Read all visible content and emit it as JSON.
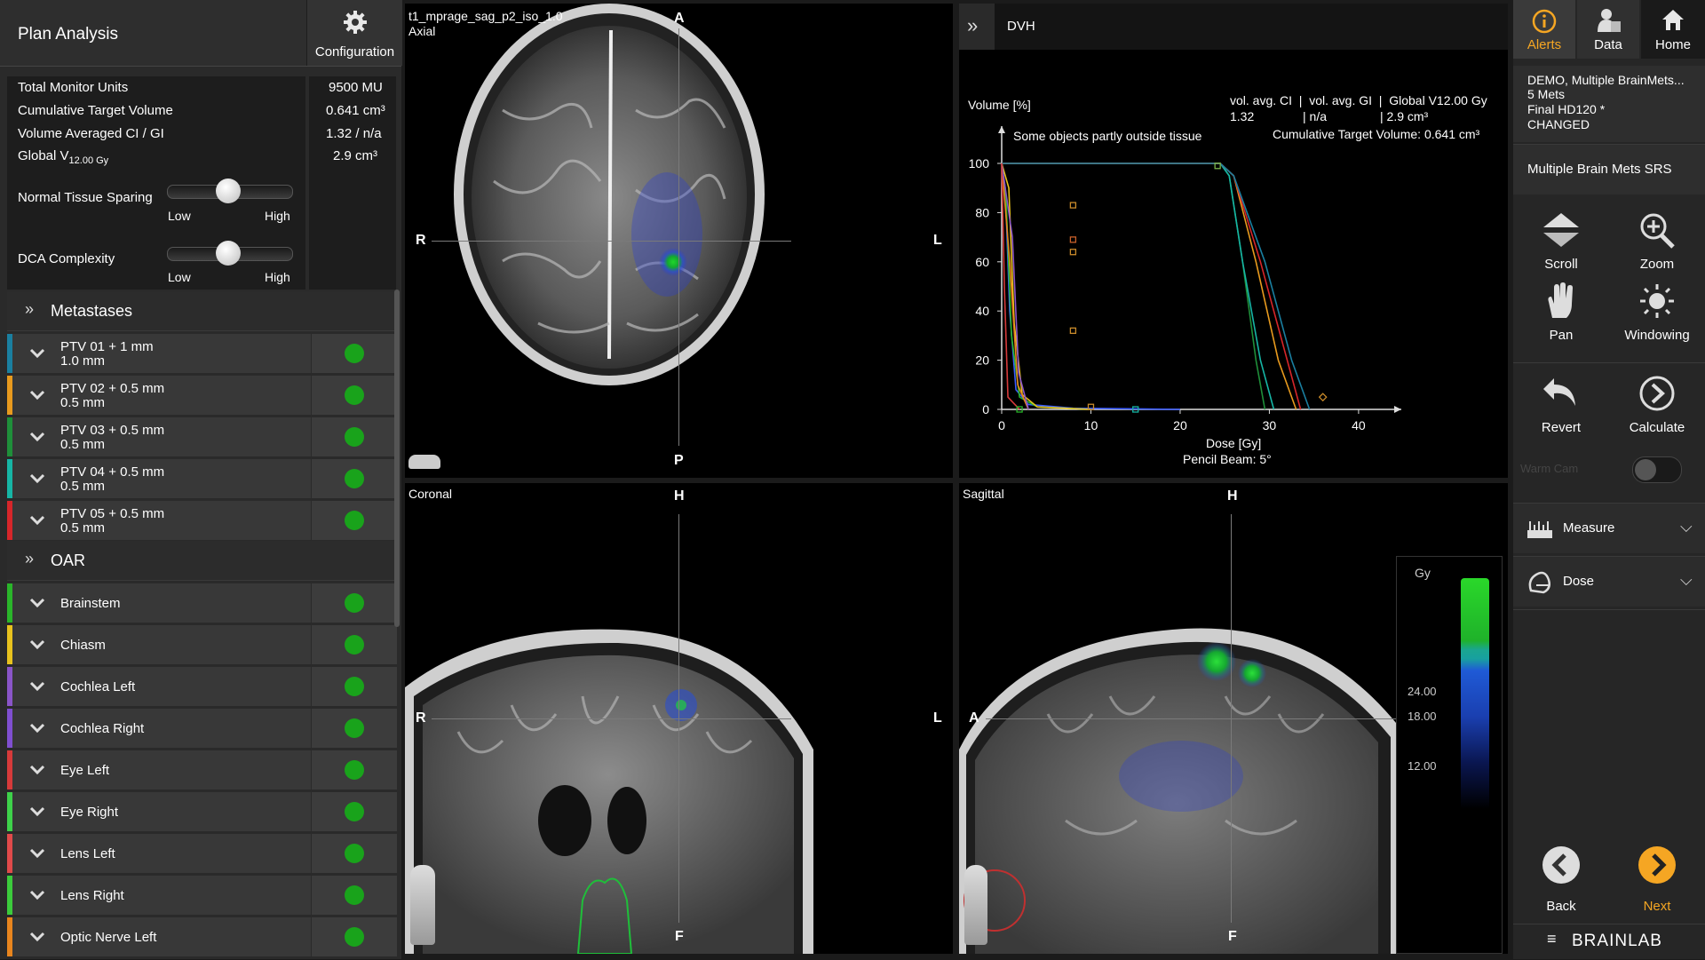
{
  "header": {
    "title": "Plan Analysis",
    "config_label": "Configuration"
  },
  "stats": [
    {
      "label": "Total Monitor Units",
      "sub": "",
      "value": "9500 MU"
    },
    {
      "label": "Cumulative Target Volume",
      "sub": "",
      "value": "0.641 cm³"
    },
    {
      "label": "Volume Averaged CI / GI",
      "sub": "",
      "value": "1.32 / n/a"
    },
    {
      "label": "Global V",
      "sub": "12.00 Gy",
      "value": "2.9 cm³"
    }
  ],
  "sliders": [
    {
      "label": "Normal Tissue Sparing",
      "low": "Low",
      "high": "High",
      "value": 0.4
    },
    {
      "label": "DCA Complexity",
      "low": "Low",
      "high": "High",
      "value": 0.4
    }
  ],
  "metastases": {
    "title": "Metastases",
    "items": [
      {
        "l1": "PTV 01 + 1 mm",
        "l2": "1.0 mm",
        "color": "#1a7fa0"
      },
      {
        "l1": "PTV 02 + 0.5 mm",
        "l2": "0.5 mm",
        "color": "#e89a1e"
      },
      {
        "l1": "PTV 03 + 0.5 mm",
        "l2": "0.5 mm",
        "color": "#1f8f3a"
      },
      {
        "l1": "PTV 04 + 0.5 mm",
        "l2": "0.5 mm",
        "color": "#16b5a5"
      },
      {
        "l1": "PTV 05 + 0.5 mm",
        "l2": "0.5 mm",
        "color": "#d6262a"
      }
    ]
  },
  "oar": {
    "title": "OAR",
    "items": [
      {
        "label": "Brainstem",
        "color": "#2ab52a"
      },
      {
        "label": "Chiasm",
        "color": "#e8c21e"
      },
      {
        "label": "Cochlea Left",
        "color": "#8a55c8"
      },
      {
        "label": "Cochlea Right",
        "color": "#7f4fd0"
      },
      {
        "label": "Eye Left",
        "color": "#d63a3a"
      },
      {
        "label": "Eye Right",
        "color": "#3ed14a"
      },
      {
        "label": "Lens Left",
        "color": "#e04a4a"
      },
      {
        "label": "Lens Right",
        "color": "#3ccb3c"
      },
      {
        "label": "Optic Nerve Left",
        "color": "#e8851e"
      }
    ]
  },
  "axial": {
    "title": "t1_mprage_sag_p2_iso_1.0",
    "subtitle": "Axial",
    "top": "A",
    "bottom": "P",
    "left": "R",
    "right": "L"
  },
  "coronal": {
    "title": "Coronal",
    "top": "H",
    "bottom": "F",
    "left": "R",
    "right": "L"
  },
  "sagittal": {
    "title": "Sagittal",
    "top": "H",
    "bottom": "F",
    "left": "A",
    "right": "P",
    "dose_scale": {
      "unit": "Gy",
      "ticks": [
        "24.00",
        "18.00",
        "12.00"
      ]
    }
  },
  "dvh": {
    "header": "DVH",
    "ylabel": "Volume [%]",
    "note": "Some objects partly outside tissue",
    "info_line1": "vol. avg. CI  |  vol. avg. GI  |  Global V12.00 Gy",
    "info_line2a": "1.32",
    "info_line2b": "| n/a",
    "info_line2c": "| 2.9 cm³",
    "info_line3": "Cumulative Target Volume: 0.641 cm³",
    "xlabel": "Dose [Gy]",
    "xlabel2": "Pencil Beam: 5°"
  },
  "chart_data": {
    "type": "line",
    "title": "",
    "xlabel": "Dose [Gy]",
    "ylabel": "Volume [%]",
    "xlim": [
      0,
      42
    ],
    "ylim": [
      0,
      100
    ],
    "xticks": [
      0,
      10,
      20,
      30,
      40
    ],
    "yticks": [
      0,
      20,
      40,
      60,
      80,
      100
    ],
    "series": [
      {
        "color": "#1f8f3a",
        "x": [
          0,
          24.5,
          25.5,
          27,
          28.5,
          29.5
        ],
        "y": [
          100,
          100,
          95,
          60,
          20,
          0
        ]
      },
      {
        "color": "#16b5a5",
        "x": [
          0,
          24.5,
          25.5,
          27,
          29,
          30.5
        ],
        "y": [
          100,
          100,
          95,
          60,
          20,
          0
        ]
      },
      {
        "color": "#e89a1e",
        "x": [
          0,
          24.5,
          26,
          28.5,
          31,
          33
        ],
        "y": [
          100,
          100,
          95,
          60,
          20,
          0
        ]
      },
      {
        "color": "#d6262a",
        "x": [
          0,
          24.5,
          26,
          29,
          32,
          33.5
        ],
        "y": [
          100,
          100,
          95,
          60,
          20,
          0
        ]
      },
      {
        "color": "#1a7fa0",
        "x": [
          0,
          24.5,
          26,
          29.5,
          32.5,
          34.5
        ],
        "y": [
          100,
          100,
          95,
          60,
          20,
          0
        ]
      },
      {
        "color": "#3b5cff",
        "x": [
          0,
          0.4,
          0.9,
          1.6,
          3,
          8,
          20
        ],
        "y": [
          100,
          90,
          40,
          8,
          2,
          0.5,
          0
        ]
      },
      {
        "color": "#2ab52a",
        "x": [
          0,
          0.5,
          1.1,
          2,
          4,
          10
        ],
        "y": [
          100,
          85,
          30,
          5,
          1,
          0
        ]
      },
      {
        "color": "#e8c21e",
        "x": [
          0,
          0.8,
          1.4,
          2.3,
          4,
          10
        ],
        "y": [
          100,
          90,
          35,
          6,
          1,
          0
        ]
      },
      {
        "color": "#e8851e",
        "x": [
          0,
          0.9,
          1.8,
          3
        ],
        "y": [
          100,
          60,
          10,
          0
        ]
      },
      {
        "color": "#8a55c8",
        "x": [
          0,
          1.2,
          1.9,
          3
        ],
        "y": [
          100,
          70,
          15,
          0
        ]
      },
      {
        "color": "#d63a3a",
        "x": [
          0,
          0.3,
          0.7,
          2
        ],
        "y": [
          100,
          50,
          5,
          0
        ]
      }
    ],
    "markers": [
      {
        "x": 8,
        "y": 83,
        "shape": "square",
        "color": "#c98a2a"
      },
      {
        "x": 8,
        "y": 69,
        "shape": "square",
        "color": "#c9602a"
      },
      {
        "x": 8,
        "y": 64,
        "shape": "square",
        "color": "#c98a2a"
      },
      {
        "x": 8,
        "y": 32,
        "shape": "square",
        "color": "#c98a2a"
      },
      {
        "x": 36,
        "y": 5,
        "shape": "diamond",
        "color": "#c98a2a"
      },
      {
        "x": 24.2,
        "y": 99,
        "shape": "square",
        "color": "#7ab34a"
      },
      {
        "x": 10,
        "y": 1,
        "shape": "square",
        "color": "#c98a2a"
      },
      {
        "x": 2,
        "y": 0,
        "shape": "square",
        "color": "#2ab52a"
      },
      {
        "x": 15,
        "y": 0,
        "shape": "square",
        "color": "#16b5a5"
      }
    ]
  },
  "right": {
    "tabs": [
      "Alerts",
      "Data",
      "Home"
    ],
    "case": [
      "DEMO, Multiple BrainMets...",
      "5 Mets",
      "Final HD120 *",
      "CHANGED"
    ],
    "plan": "Multiple Brain Mets SRS",
    "tools": [
      "Scroll",
      "Zoom",
      "Pan",
      "Windowing",
      "Revert",
      "Calculate"
    ],
    "toggle_label": "Warm Cam",
    "accordions": [
      "Measure",
      "Dose"
    ],
    "back": "Back",
    "next": "Next",
    "brand": "BRAINLAB"
  }
}
